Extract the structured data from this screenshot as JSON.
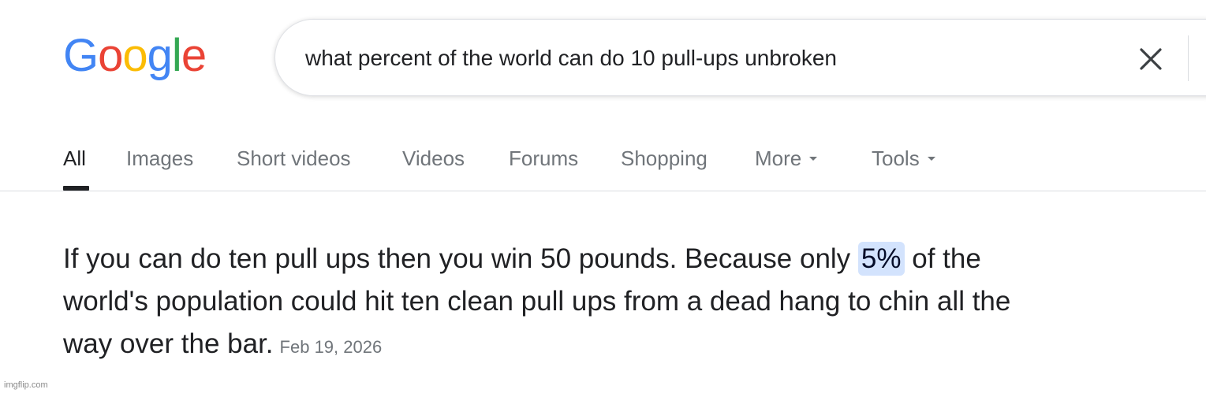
{
  "logo": {
    "letters": [
      {
        "char": "G",
        "color": "#4285F4"
      },
      {
        "char": "o",
        "color": "#EA4335"
      },
      {
        "char": "o",
        "color": "#FBBC05"
      },
      {
        "char": "g",
        "color": "#4285F4"
      },
      {
        "char": "l",
        "color": "#34A853"
      },
      {
        "char": "e",
        "color": "#EA4335"
      }
    ]
  },
  "search": {
    "query": "what percent of the world can do 10 pull-ups unbroken",
    "clear_icon": "close-icon"
  },
  "tabs": {
    "all": "All",
    "images": "Images",
    "short_videos": "Short videos",
    "videos": "Videos",
    "forums": "Forums",
    "shopping": "Shopping",
    "more": "More",
    "tools": "Tools",
    "active": "All"
  },
  "snippet": {
    "text_before": "If you can do ten pull ups then you win 50 pounds. Because only ",
    "highlight": "5%",
    "text_after": " of the world's population could hit ten clean pull ups from a dead hang to chin all the way over the bar.",
    "date": "Feb 19, 2026"
  },
  "watermark": "imgflip.com",
  "colors": {
    "highlight_bg": "#d3e3fd",
    "text": "#202124",
    "muted": "#70757a"
  }
}
